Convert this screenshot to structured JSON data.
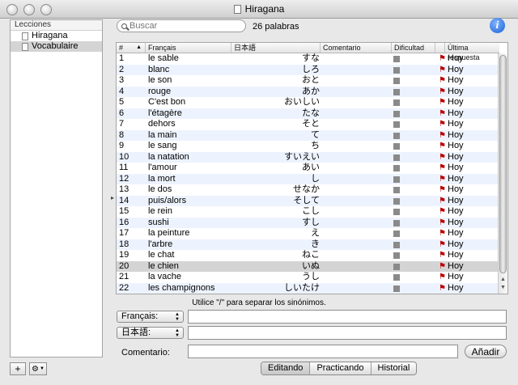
{
  "window": {
    "title": "Hiragana"
  },
  "sidebar": {
    "header": "Lecciones",
    "items": [
      {
        "label": "Hiragana",
        "selected": false
      },
      {
        "label": "Vocabulaire",
        "selected": true
      }
    ],
    "add_label": "+",
    "gear_label": "⚙"
  },
  "search": {
    "placeholder": "Buscar",
    "count": "26 palabras"
  },
  "table": {
    "columns": [
      "#",
      "Français",
      "日本語",
      "Comentario",
      "Dificultad",
      "",
      "Última respuesta"
    ],
    "rows": [
      {
        "n": "1",
        "fr": "le sable",
        "jp": "すな",
        "last": "Hoy"
      },
      {
        "n": "2",
        "fr": "blanc",
        "jp": "しろ",
        "last": "Hoy"
      },
      {
        "n": "3",
        "fr": "le son",
        "jp": "おと",
        "last": "Hoy"
      },
      {
        "n": "4",
        "fr": "rouge",
        "jp": "あか",
        "last": "Hoy"
      },
      {
        "n": "5",
        "fr": "C'est bon",
        "jp": "おいしい",
        "last": "Hoy"
      },
      {
        "n": "6",
        "fr": "l'étagère",
        "jp": "たな",
        "last": "Hoy"
      },
      {
        "n": "7",
        "fr": "dehors",
        "jp": "そと",
        "last": "Hoy"
      },
      {
        "n": "8",
        "fr": "la main",
        "jp": "て",
        "last": "Hoy"
      },
      {
        "n": "9",
        "fr": "le sang",
        "jp": "ち",
        "last": "Hoy"
      },
      {
        "n": "10",
        "fr": "la natation",
        "jp": "すいえい",
        "last": "Hoy"
      },
      {
        "n": "11",
        "fr": "l'amour",
        "jp": "あい",
        "last": "Hoy"
      },
      {
        "n": "12",
        "fr": "la mort",
        "jp": "し",
        "last": "Hoy"
      },
      {
        "n": "13",
        "fr": "le dos",
        "jp": "せなか",
        "last": "Hoy"
      },
      {
        "n": "14",
        "fr": "puis/alors",
        "jp": "そして",
        "last": "Hoy"
      },
      {
        "n": "15",
        "fr": "le rein",
        "jp": "こし",
        "last": "Hoy"
      },
      {
        "n": "16",
        "fr": "sushi",
        "jp": "すし",
        "last": "Hoy"
      },
      {
        "n": "17",
        "fr": "la peinture",
        "jp": "え",
        "last": "Hoy"
      },
      {
        "n": "18",
        "fr": "l'arbre",
        "jp": "き",
        "last": "Hoy"
      },
      {
        "n": "19",
        "fr": "le chat",
        "jp": "ねこ",
        "last": "Hoy"
      },
      {
        "n": "20",
        "fr": "le chien",
        "jp": "いぬ",
        "last": "Hoy"
      },
      {
        "n": "21",
        "fr": "la vache",
        "jp": "うし",
        "last": "Hoy"
      },
      {
        "n": "22",
        "fr": "les champignons",
        "jp": "しいたけ",
        "last": "Hoy"
      }
    ],
    "selected_row": 20
  },
  "editor": {
    "hint": "Utilice \"/\" para separar los sinónimos.",
    "field1_select": "Français:",
    "field2_select": "日本語:",
    "comment_label": "Comentario:",
    "add_button": "Añadir"
  },
  "modes": {
    "tabs": [
      "Editando",
      "Practicando",
      "Historial"
    ],
    "active": 0
  },
  "colors": {
    "row_alt": "#edf3fe",
    "row_selected": "#d4d4d4",
    "info_blue": "#1a5fd6"
  },
  "icons": {
    "info": "info-icon",
    "search": "search-icon",
    "flag": "flag-icon",
    "gear": "gear-icon"
  }
}
